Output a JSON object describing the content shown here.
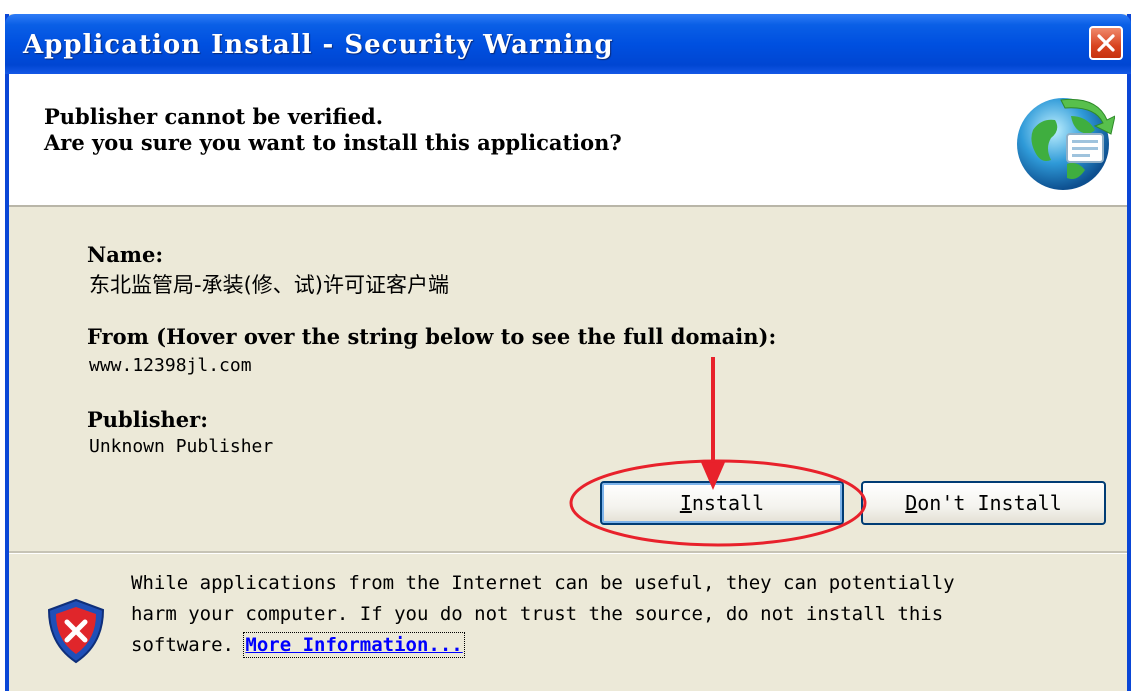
{
  "window": {
    "title": "Application Install - Security Warning"
  },
  "header": {
    "line1": "Publisher cannot be verified.",
    "line2": "Are you sure you want to install this application?"
  },
  "details": {
    "name_label": "Name",
    "name_value": "东北监管局-承装(修、试)许可证客户端",
    "from_label": "From (Hover over the string below to see the full domain)",
    "from_value": "www.12398jl.com",
    "publisher_label": "Publisher",
    "publisher_value": "Unknown Publisher"
  },
  "buttons": {
    "install_mnemonic": "I",
    "install_rest": "nstall",
    "dont_install_mnemonic": "D",
    "dont_install_rest": "on't Install"
  },
  "warning": {
    "line1": "While applications from the Internet can be useful, they can potentially",
    "line2": "harm your computer. If you do not trust the source, do not install this",
    "line3_prefix": "software. ",
    "more_info_link": "More Information..."
  },
  "colors": {
    "titlebar": "#0050e0",
    "dialog_body": "#ece9d8",
    "annotation_red": "#e8212b",
    "link": "#0000ff"
  },
  "icons": {
    "close": "close-icon",
    "globe": "globe-install-icon",
    "shield": "shield-warning-icon"
  }
}
